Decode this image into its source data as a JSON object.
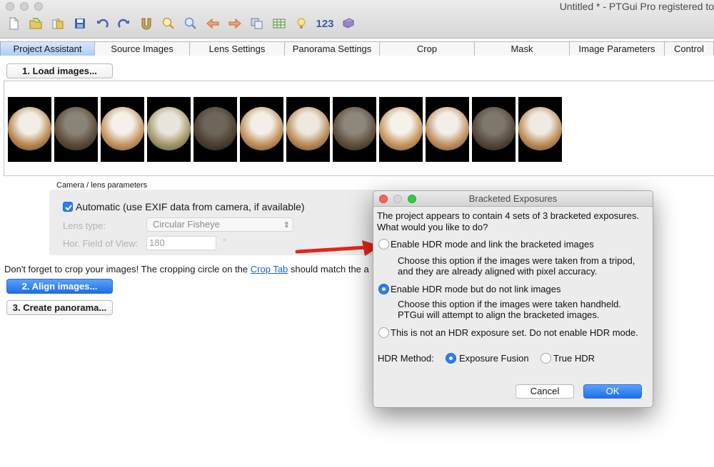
{
  "window": {
    "title": "Untitled * - PTGui Pro registered to"
  },
  "toolbar": {
    "icons": [
      "new-file-icon",
      "open-folder-icon",
      "open-recent-icon",
      "save-icon",
      "undo-icon",
      "redo-icon",
      "magnet-icon",
      "zoom-in-icon",
      "zoom-out-icon",
      "arrow-left-icon",
      "arrow-right-icon",
      "copy-images-icon",
      "table-icon",
      "lightbulb-icon",
      "numbers-icon",
      "help-book-icon"
    ],
    "numbers_label": "123"
  },
  "tabs": [
    {
      "label": "Project Assistant",
      "active": true
    },
    {
      "label": "Source Images"
    },
    {
      "label": "Lens Settings"
    },
    {
      "label": "Panorama Settings"
    },
    {
      "label": "Crop"
    },
    {
      "label": "Mask"
    },
    {
      "label": "Image Parameters"
    },
    {
      "label": "Control"
    }
  ],
  "main": {
    "load_button": "1. Load images...",
    "camera_group_label": "Camera / lens parameters",
    "automatic_label": "Automatic (use EXIF data from camera, if available)",
    "lens_type_label": "Lens type:",
    "lens_type_value": "Circular Fisheye",
    "hfov_label": "Hor. Field of View:",
    "hfov_value": "180",
    "hfov_unit": "°",
    "note_prefix": "Don't forget to crop your images! The cropping circle on the ",
    "note_link": "Crop Tab",
    "note_suffix": " should match the a",
    "align_button": "2. Align images...",
    "create_button": "3. Create panorama..."
  },
  "dialog": {
    "title": "Bracketed Exposures",
    "intro_line1": "The project appears to contain 4 sets of 3 bracketed exposures.",
    "intro_line2": "What would you like to do?",
    "option1_label": "Enable HDR mode and link the bracketed images",
    "option1_desc1": "Choose this option if the images were taken from a tripod,",
    "option1_desc2": "and they are already aligned with pixel accuracy.",
    "option2_label": "Enable HDR mode but do not link images",
    "option2_desc1": "Choose this option if the images were taken handheld.",
    "option2_desc2": "PTGui will attempt to align the bracketed images.",
    "option3_label": "This is not an HDR exposure set. Do not enable HDR mode.",
    "hdr_method_label": "HDR Method:",
    "method1_label": "Exposure Fusion",
    "method2_label": "True HDR",
    "cancel_label": "Cancel",
    "ok_label": "OK"
  },
  "colors": {
    "accent_blue": "#2c7cf2",
    "arrow_red": "#e3241c",
    "link_blue": "#1f5fd8"
  }
}
